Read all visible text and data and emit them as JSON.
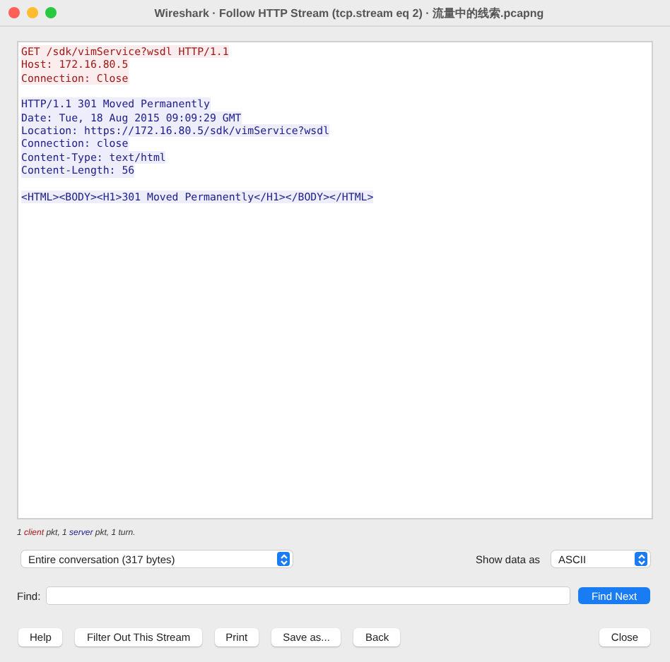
{
  "window": {
    "title": "Wireshark · Follow HTTP Stream (tcp.stream eq 2) · 流量中的线索.pcapng"
  },
  "stream": [
    {
      "kind": "client",
      "lines": [
        "GET /sdk/vimService?wsdl HTTP/1.1",
        "Host: 172.16.80.5",
        "Connection: Close"
      ]
    },
    {
      "kind": "server",
      "lines": [
        "HTTP/1.1 301 Moved Permanently",
        "Date: Tue, 18 Aug 2015 09:09:29 GMT",
        "Location: https://172.16.80.5/sdk/vimService?wsdl",
        "Connection: close",
        "Content-Type: text/html",
        "Content-Length: 56"
      ]
    },
    {
      "kind": "server",
      "lines": [
        "<HTML><BODY><H1>301 Moved Permanently</H1></BODY></HTML>"
      ]
    }
  ],
  "status": [
    {
      "kind": "plain",
      "text": "1 "
    },
    {
      "kind": "client",
      "text": "client"
    },
    {
      "kind": "plain",
      "text": " pkt, 1 "
    },
    {
      "kind": "server",
      "text": "server"
    },
    {
      "kind": "plain",
      "text": " pkt, 1 turn."
    }
  ],
  "conversation_select": {
    "value": "Entire conversation (317 bytes)"
  },
  "show_data": {
    "label": "Show data as",
    "value": "ASCII"
  },
  "find": {
    "label": "Find:",
    "button": "Find Next"
  },
  "buttons": [
    "Help",
    "Filter Out This Stream",
    "Print",
    "Save as...",
    "Back"
  ],
  "close_button": "Close"
}
